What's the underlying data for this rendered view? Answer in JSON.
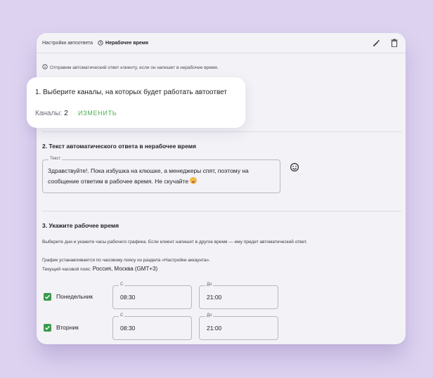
{
  "header": {
    "title": "Настройки автоответа",
    "subtitle": "Нерабочее время",
    "clock_icon": "clock-icon",
    "edit_icon": "pencil-icon",
    "delete_icon": "trash-icon"
  },
  "info": {
    "icon": "info-icon",
    "text": "Отправим автоматический ответ клиенту, если он напишет в нерабочее время."
  },
  "section1": {
    "title": "1. Выберите каналы, на которых будет работать автоответ",
    "channels_label": "Каналы:",
    "channels_count": "2",
    "change_label": "ИЗМЕНИТЬ"
  },
  "section2": {
    "title": "2. Текст автоматического ответа в нерабочее время",
    "field_label": "Текст",
    "text": "Здравствуйте!. Пока избушка на клюшке, а менеджеры спят, поэтому на сообщение ответим в рабочее время. Не скучайте",
    "emoji_icon": "smiley-icon"
  },
  "section3": {
    "title": "3. Укажите рабочее время",
    "description": "Выберите дни и укажите часы рабочего графика. Если клиент напишет в другое время — ему придет автоматический ответ.",
    "tz_note": "График устанавливается по часовому поясу из раздела «Настройки аккаунта».",
    "tz_label": "Текущий часовой пояс:",
    "tz_value": "Россия, Москва (GMT+3)",
    "days": [
      {
        "name": "Понедельник",
        "checked": true,
        "from_label": "С",
        "from": "08:30",
        "to_label": "До",
        "to": "21:00"
      },
      {
        "name": "Вторник",
        "checked": true,
        "from_label": "С",
        "from": "08:30",
        "to_label": "До",
        "to": "21:00"
      }
    ]
  },
  "colors": {
    "accent": "#4caf50",
    "checkbox": "#3a9a4e",
    "background": "#ddd3f0",
    "card": "#f3f2f6"
  }
}
